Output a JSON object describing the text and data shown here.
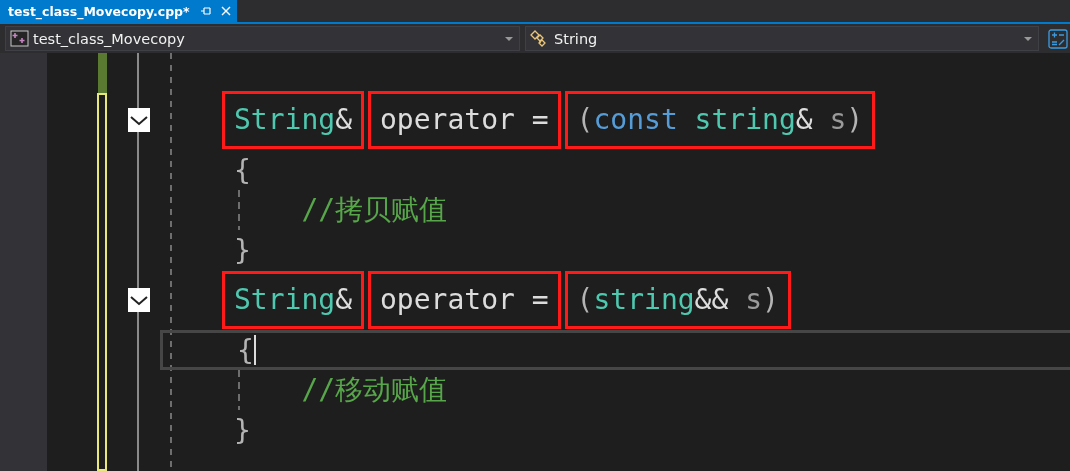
{
  "tab": {
    "label": "test_class_Movecopy.cpp*",
    "selected": true
  },
  "navigation": {
    "project": "test_class_Movecopy",
    "scope": "String"
  },
  "code_lines": [
    {
      "collapsible": true,
      "indented": false,
      "caret": false,
      "segments": [
        {
          "boxed": true,
          "tokens": [
            {
              "text": "String",
              "kind": "type"
            },
            {
              "text": "&",
              "kind": "plain"
            }
          ]
        },
        {
          "boxed": true,
          "tokens": [
            {
              "text": "operator =",
              "kind": "plain"
            }
          ]
        },
        {
          "boxed": true,
          "tokens": [
            {
              "text": "(",
              "kind": "punct"
            },
            {
              "text": "const",
              "kind": "keyword"
            },
            {
              "text": " string",
              "kind": "type"
            },
            {
              "text": "&",
              "kind": "plain"
            },
            {
              "text": " s",
              "kind": "param"
            },
            {
              "text": ")",
              "kind": "punct"
            }
          ]
        }
      ]
    },
    {
      "collapsible": false,
      "indented": false,
      "caret": false,
      "segments": [
        {
          "boxed": false,
          "tokens": [
            {
              "text": "{",
              "kind": "punct"
            }
          ]
        }
      ]
    },
    {
      "collapsible": false,
      "indented": true,
      "caret": false,
      "segments": [
        {
          "boxed": false,
          "tokens": [
            {
              "text": "//拷贝赋值",
              "kind": "comment"
            }
          ]
        }
      ]
    },
    {
      "collapsible": false,
      "indented": false,
      "caret": false,
      "segments": [
        {
          "boxed": false,
          "tokens": [
            {
              "text": "}",
              "kind": "punct"
            }
          ]
        }
      ]
    },
    {
      "collapsible": true,
      "indented": false,
      "caret": false,
      "segments": [
        {
          "boxed": true,
          "tokens": [
            {
              "text": "String",
              "kind": "type"
            },
            {
              "text": "&",
              "kind": "plain"
            }
          ]
        },
        {
          "boxed": true,
          "tokens": [
            {
              "text": "operator =",
              "kind": "plain"
            }
          ]
        },
        {
          "boxed": true,
          "tokens": [
            {
              "text": "(",
              "kind": "punct"
            },
            {
              "text": "string",
              "kind": "type"
            },
            {
              "text": "&&",
              "kind": "plain"
            },
            {
              "text": " s",
              "kind": "param"
            },
            {
              "text": ")",
              "kind": "punct"
            }
          ]
        }
      ]
    },
    {
      "collapsible": false,
      "indented": false,
      "caret": true,
      "segments": [
        {
          "boxed": false,
          "tokens": [
            {
              "text": "{",
              "kind": "punct"
            }
          ]
        }
      ]
    },
    {
      "collapsible": false,
      "indented": true,
      "caret": false,
      "segments": [
        {
          "boxed": false,
          "tokens": [
            {
              "text": "//移动赋值",
              "kind": "comment"
            }
          ]
        }
      ]
    },
    {
      "collapsible": false,
      "indented": false,
      "caret": false,
      "segments": [
        {
          "boxed": false,
          "tokens": [
            {
              "text": "}",
              "kind": "punct"
            }
          ]
        }
      ]
    }
  ]
}
